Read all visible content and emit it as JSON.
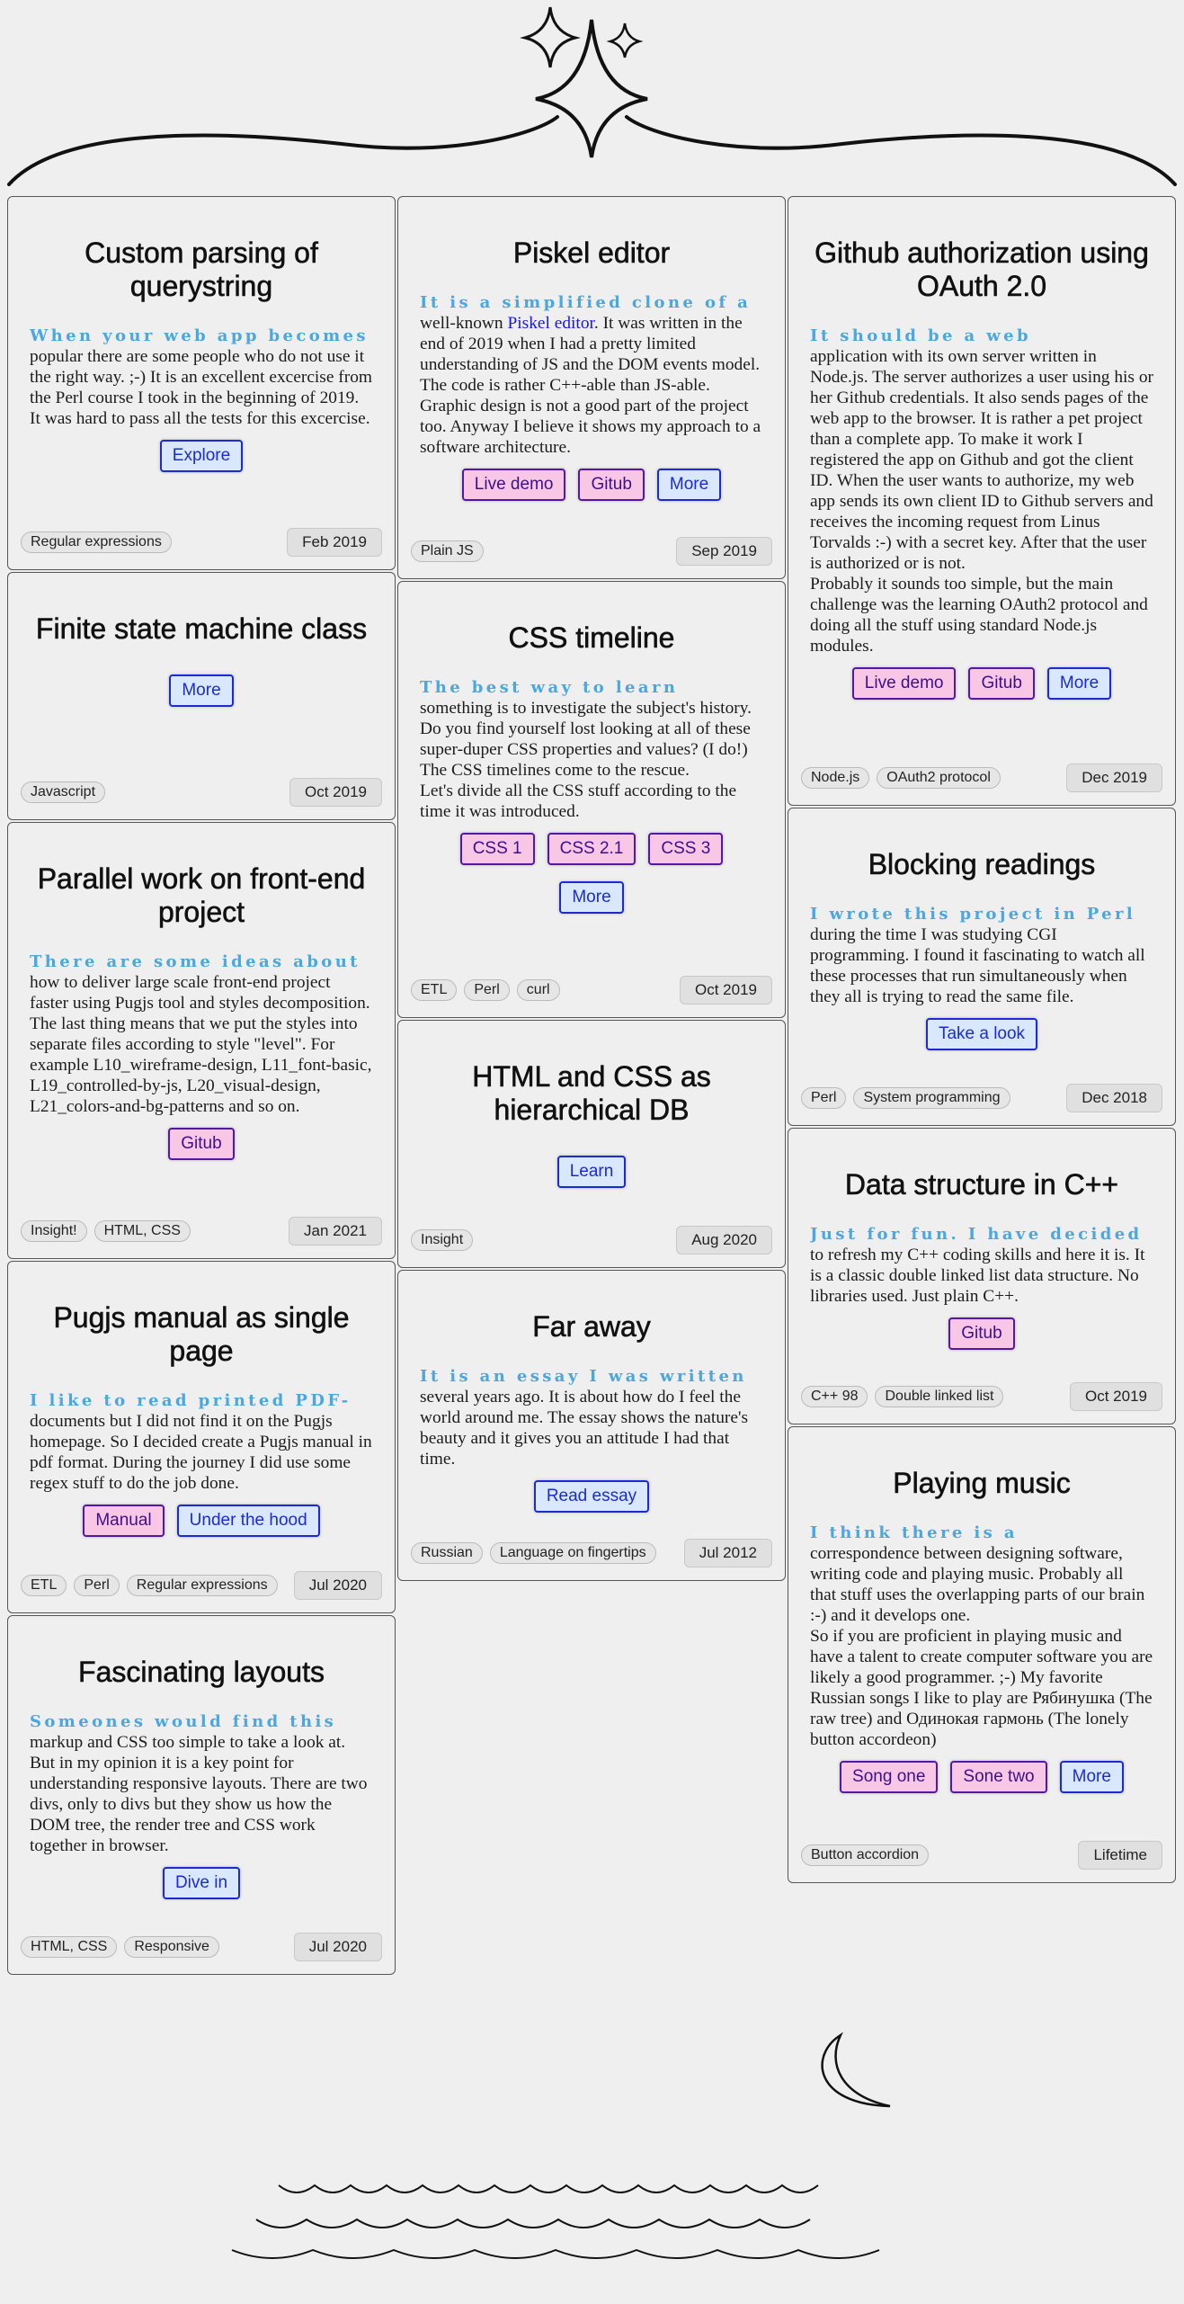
{
  "cards": {
    "querystring": {
      "title": "Custom parsing of querystring",
      "lead": "When your web app becomes",
      "body": "popular there are some people who do not use it the right way. ;-) It is an excellent excercise from the Perl course I took in the beginning of 2019. It was hard to pass all the tests for this excercise.",
      "buttons": [
        "Explore"
      ],
      "tags": [
        "Regular expressions"
      ],
      "date": "Feb 2019"
    },
    "fsm": {
      "title": "Finite state machine class",
      "buttons": [
        "More"
      ],
      "tags": [
        "Javascript"
      ],
      "date": "Oct 2019"
    },
    "parallel": {
      "title": "Parallel work on front-end project",
      "lead": "There are some ideas about",
      "body": "how to deliver large scale front-end project faster using Pugjs tool and styles decomposition. The last thing means that we put the styles into separate files according to style \"level\". For example L10_wireframe-design, L11_font-basic, L19_controlled-by-js, L20_visual-design, L21_colors-and-bg-patterns and so on.",
      "buttons": [
        "Gitub"
      ],
      "tags": [
        "Insight!",
        "HTML, CSS"
      ],
      "date": "Jan 2021"
    },
    "pugjs": {
      "title": "Pugjs manual as single page",
      "lead": "I like to read printed PDF-",
      "body": "documents but I did not find it on the Pugjs homepage. So I decided create a Pugjs manual in pdf format. During the journey I did use some regex stuff to do the job done.",
      "buttons": [
        "Manual",
        "Under the hood"
      ],
      "tags": [
        "ETL",
        "Perl",
        "Regular expressions"
      ],
      "date": "Jul 2020"
    },
    "layouts": {
      "title": "Fascinating layouts",
      "lead": "Someones would find this",
      "body": "markup and CSS too simple to take a look at. But in my opinion it is a key point for understanding responsive layouts. There are two divs, only to divs but they show us how the DOM tree, the render tree and CSS work together in browser.",
      "buttons": [
        "Dive in"
      ],
      "tags": [
        "HTML, CSS",
        "Responsive"
      ],
      "date": "Jul 2020"
    },
    "piskel": {
      "title": "Piskel editor",
      "lead": "It is a simplified clone of a",
      "body_pre": "well-known ",
      "body_link": "Piskel editor",
      "body_post": ". It was written in the end of 2019 when I had a pretty limited understanding of JS and the DOM events model. The code is rather C++-able than JS-able. Graphic design is not a good part of the project too. Anyway I believe it shows my approach to a software architecture.",
      "buttons": [
        "Live demo",
        "Gitub",
        "More"
      ],
      "tags": [
        "Plain JS"
      ],
      "date": "Sep 2019"
    },
    "timeline": {
      "title": "CSS timeline",
      "lead": "The best way to learn",
      "body": "something is to investigate the subject's history. Do you find yourself lost looking at all of these super-duper CSS properties and values? (I do!) The CSS timelines come to the rescue.",
      "body2": "Let's divide all the CSS stuff according to the time it was introduced.",
      "buttons": [
        "CSS 1",
        "CSS 2.1",
        "CSS 3"
      ],
      "buttons2": [
        "More"
      ],
      "tags": [
        "ETL",
        "Perl",
        "curl"
      ],
      "date": "Oct 2019"
    },
    "hierarchical": {
      "title": "HTML and CSS as hierarchical DB",
      "buttons": [
        "Learn"
      ],
      "tags": [
        "Insight"
      ],
      "date": "Aug 2020"
    },
    "faraway": {
      "title": "Far away",
      "lead": "It is an essay I was written",
      "body": "several years ago. It is about how do I feel the world around me. The essay shows the nature's beauty and it gives you an attitude I had that time.",
      "buttons": [
        "Read essay"
      ],
      "tags": [
        "Russian",
        "Language on fingertips"
      ],
      "date": "Jul 2012"
    },
    "oauth": {
      "title": "Github authorization using OAuth 2.0",
      "lead": "It should be a web",
      "body": "application with its own server written in Node.js. The server authorizes a user using his or her Github credentials. It also sends pages of the web app to the browser. It is rather a pet project than a complete app. To make it work I registered the app on Github and got the client ID. When the user wants to authorize, my web app sends its own client ID to Github servers and receives the incoming request from Linus Torvalds :-) with a secret key. After that the user is authorized or is not.",
      "body2": "Probably it sounds too simple, but the main challenge was the learning OAuth2 protocol and doing all the stuff using standard Node.js modules.",
      "buttons": [
        "Live demo",
        "Gitub",
        "More"
      ],
      "tags": [
        "Node.js",
        "OAuth2 protocol"
      ],
      "date": "Dec 2019"
    },
    "blocking": {
      "title": "Blocking readings",
      "lead": "I wrote this project in Perl",
      "body": "during the time I was studying CGI programming. I found it fascinating to watch all these processes that run simultaneously when they all is trying to read the same file.",
      "buttons": [
        "Take a look"
      ],
      "tags": [
        "Perl",
        "System programming"
      ],
      "date": "Dec 2018"
    },
    "datastruct": {
      "title": "Data structure in C++",
      "lead": "Just for fun. I have decided",
      "body": "to refresh my C++ coding skills and here it is. It is a classic double linked list data structure. No libraries used. Just plain C++.",
      "buttons": [
        "Gitub"
      ],
      "tags": [
        "C++ 98",
        "Double linked list"
      ],
      "date": "Oct 2019"
    },
    "music": {
      "title": "Playing music",
      "lead": "I think there is a",
      "body": "correspondence between designing software, writing code and playing music. Probably all that stuff uses the overlapping parts of our brain :-) and it develops one.",
      "body2": "So if you are proficient in playing music and have a talent to create computer software you are likely a good programmer. ;-) My favorite Russian songs I like to play are Рябинушка (The raw tree) and Одинокая гармонь (The lonely button accordeon)",
      "buttons": [
        "Song one",
        "Sone two",
        "More"
      ],
      "tags": [
        "Button accordion"
      ],
      "date": "Lifetime"
    }
  },
  "colors": {
    "lead": "#4aa7e0",
    "button_blue_bg": "#d9e8ff",
    "button_pink_bg": "#f8c7e6",
    "border": "#555555",
    "background": "#efefef"
  },
  "icons": [
    "star-icon",
    "crescent-moon-icon",
    "waves-icon"
  ]
}
